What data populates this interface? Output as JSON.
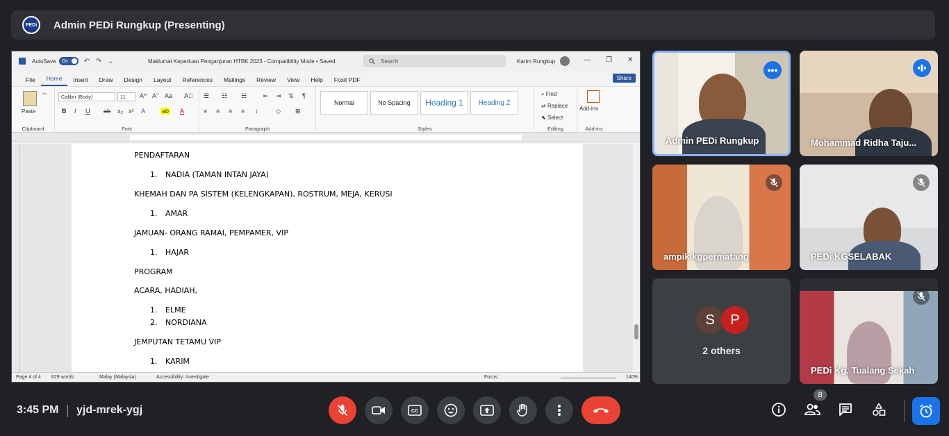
{
  "presenting": {
    "logo_text": "PEDi",
    "title": "Admin PEDi Rungkup (Presenting)"
  },
  "word": {
    "autosave_label": "AutoSave",
    "autosave_state": "On",
    "doc_title": "Maklumat Keperluan Penganjuran HTBK 2023  -  Compatibility Mode • Saved",
    "search_placeholder": "Search",
    "user_name": "Karim Rungkup",
    "tabs": [
      "File",
      "Home",
      "Insert",
      "Draw",
      "Design",
      "Layout",
      "References",
      "Mailings",
      "Review",
      "View",
      "Help",
      "Foxit PDF"
    ],
    "active_tab": "Home",
    "share_label": "Share",
    "ribbon": {
      "paste_label": "Paste",
      "clipboard_label": "Clipboard",
      "font_name": "Calibri (Body)",
      "font_size": "11",
      "font_label": "Font",
      "paragraph_label": "Paragraph",
      "styles": [
        "Normal",
        "No Spacing",
        "Heading 1",
        "Heading 2"
      ],
      "styles_label": "Styles",
      "find_label": "Find",
      "replace_label": "Replace",
      "select_label": "Select",
      "editing_label": "Editing",
      "addins_label": "Add-ins",
      "addins_group_label": "Add-ins"
    },
    "document": {
      "lines": [
        {
          "type": "heading",
          "text": "PENDAFTARAN"
        },
        {
          "type": "item",
          "num": "1.",
          "text": "NADIA (TAMAN INTAN JAYA)"
        },
        {
          "type": "heading",
          "text": "KHEMAH DAN PA SISTEM (KELENGKAPAN), ROSTRUM, MEJA, KERUSI"
        },
        {
          "type": "item",
          "num": "1.",
          "text": "AMAR"
        },
        {
          "type": "heading",
          "text": "JAMUAN- ORANG RAMAI, PEMPAMER, VIP"
        },
        {
          "type": "item",
          "num": "1.",
          "text": "HAJAR"
        },
        {
          "type": "heading",
          "text": "PROGRAM"
        },
        {
          "type": "heading",
          "text": "ACARA, HADIAH,"
        },
        {
          "type": "item",
          "num": "1.",
          "text": "ELME"
        },
        {
          "type": "item",
          "num": "2.",
          "text": "NORDIANA"
        },
        {
          "type": "heading",
          "text": "JEMPUTAN TETAMU VIP"
        },
        {
          "type": "item",
          "num": "1.",
          "text": "KARIM"
        }
      ]
    },
    "status": {
      "page": "Page 4 of 4",
      "words": "629 words",
      "language": "Malay (Malaysia)",
      "accessibility": "Accessibility: Investigate",
      "focus": "Focus",
      "zoom": "140%"
    }
  },
  "participants": [
    {
      "name": "Admin PEDi Rungkup",
      "state": "speaking"
    },
    {
      "name": "Mohammad Ridha Taju...",
      "state": "speaking"
    },
    {
      "name": "ampik kgpermatang",
      "state": "muted"
    },
    {
      "name": "PEDi KGSELABAK",
      "state": "muted"
    },
    {
      "name": "PEDi Kg. Tualang Sekah",
      "state": "muted"
    }
  ],
  "others": {
    "initials": [
      "S",
      "P"
    ],
    "colors": [
      "#5d4037",
      "#c5221f"
    ],
    "label": "2 others"
  },
  "bottom": {
    "time": "3:45 PM",
    "meeting_code": "yjd-mrek-ygj",
    "people_count": "8"
  }
}
